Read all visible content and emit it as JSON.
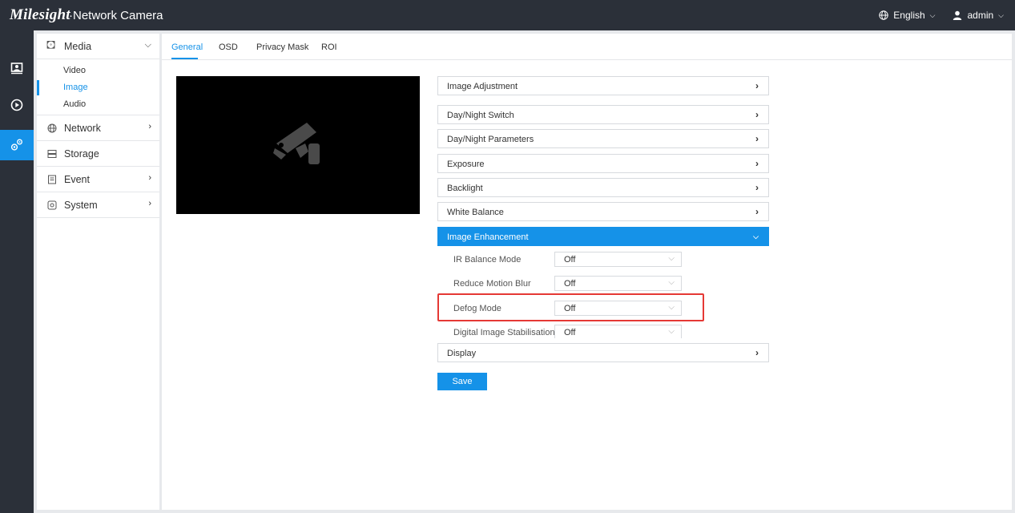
{
  "header": {
    "brand": "Milesight",
    "product": "·Network Camera",
    "language": "English",
    "user": "admin"
  },
  "iconbar": {
    "items": [
      {
        "icon": "live-view-icon"
      },
      {
        "icon": "playback-icon"
      },
      {
        "icon": "settings-icon",
        "active": true
      }
    ]
  },
  "sidebar": {
    "media": {
      "label": "Media",
      "sub": [
        "Video",
        "Image",
        "Audio"
      ]
    },
    "network": {
      "label": "Network"
    },
    "storage": {
      "label": "Storage"
    },
    "event": {
      "label": "Event"
    },
    "system": {
      "label": "System"
    }
  },
  "tabs": [
    "General",
    "OSD",
    "Privacy Mask",
    "ROI"
  ],
  "panels": {
    "image_adjustment": "Image Adjustment",
    "day_night_switch": "Day/Night Switch",
    "day_night_parameters": "Day/Night Parameters",
    "exposure": "Exposure",
    "backlight": "Backlight",
    "white_balance": "White Balance",
    "image_enhancement": "Image Enhancement",
    "display": "Display"
  },
  "enhancement": {
    "ir_balance": {
      "label": "IR Balance Mode",
      "value": "Off"
    },
    "reduce_motion_blur": {
      "label": "Reduce Motion Blur",
      "value": "Off"
    },
    "defog": {
      "label": "Defog Mode",
      "value": "Off"
    },
    "stabilisation": {
      "label": "Digital Image Stabilisation",
      "value": "Off"
    }
  },
  "save_label": "Save",
  "colors": {
    "accent": "#1592e8",
    "topbar": "#2b3039",
    "highlight": "#e53935"
  }
}
